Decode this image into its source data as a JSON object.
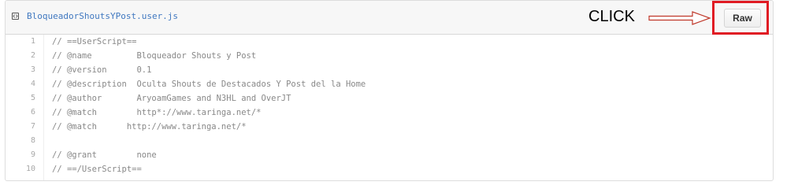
{
  "file": {
    "name": "BloqueadorShoutsYPost.user.js",
    "icon": "file-code-icon"
  },
  "annotation": {
    "click_label": "CLICK",
    "arrow_icon": "right-arrow-icon",
    "highlight_color": "#e01b24"
  },
  "toolbar": {
    "raw_label": "Raw"
  },
  "code": {
    "lines": [
      {
        "num": "1",
        "text": "// ==UserScript=="
      },
      {
        "num": "2",
        "text": "// @name         Bloqueador Shouts y Post"
      },
      {
        "num": "3",
        "text": "// @version      0.1"
      },
      {
        "num": "4",
        "text": "// @description  Oculta Shouts de Destacados Y Post del la Home"
      },
      {
        "num": "5",
        "text": "// @author       AryoamGames and N3HL and OverJT"
      },
      {
        "num": "6",
        "text": "// @match        http*://www.taringa.net/*"
      },
      {
        "num": "7",
        "text": "// @match      http://www.taringa.net/*"
      },
      {
        "num": "8",
        "text": ""
      },
      {
        "num": "9",
        "text": "// @grant        none"
      },
      {
        "num": "10",
        "text": "// ==/UserScript=="
      }
    ]
  }
}
